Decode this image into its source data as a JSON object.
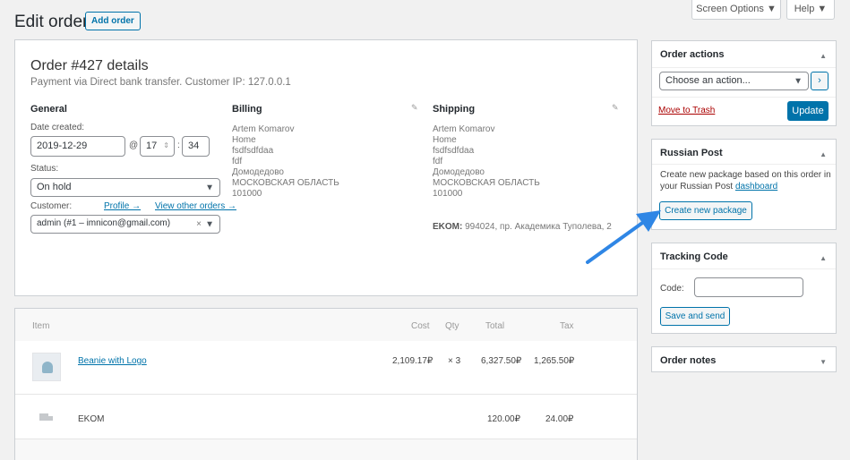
{
  "header": {
    "title": "Edit order",
    "add_order": "Add order",
    "screen_options": "Screen Options ▼",
    "help": "Help ▼"
  },
  "order": {
    "heading": "Order #427 details",
    "subheading": "Payment via Direct bank transfer. Customer IP: 127.0.0.1",
    "general": {
      "title": "General",
      "date_label": "Date created:",
      "date_value": "2019-12-29",
      "at": "@",
      "hour": "17",
      "minute": "34",
      "colon": ":",
      "status_label": "Status:",
      "status_value": "On hold",
      "customer_label": "Customer:",
      "profile_link": "Profile →",
      "other_orders_link": "View other orders →",
      "customer_value": "admin (#1 – imnicon@gmail.com)"
    },
    "billing": {
      "title": "Billing",
      "lines": [
        "Artem Komarov",
        "Home",
        "fsdfsdfdaa",
        "fdf",
        "Домодедово",
        "МОСКОВСКАЯ ОБЛАСТЬ",
        "101000"
      ]
    },
    "shipping": {
      "title": "Shipping",
      "lines": [
        "Artem Komarov",
        "Home",
        "fsdfsdfdaa",
        "fdf",
        "Домодедово",
        "МОСКОВСКАЯ ОБЛАСТЬ",
        "101000"
      ],
      "ekom_label": "EKOM:",
      "ekom_value": "994024, пр. Академика Туполева, 2"
    }
  },
  "items": {
    "headers": {
      "item": "Item",
      "cost": "Cost",
      "qty": "Qty",
      "total": "Total",
      "tax": "Tax"
    },
    "rows": [
      {
        "name": "Beanie with Logo",
        "cost": "2,109.17₽",
        "qty": "× 3",
        "total": "6,327.50₽",
        "tax": "1,265.50₽"
      }
    ],
    "shipping_row": {
      "name": "EKOM",
      "total": "120.00₽",
      "tax": "24.00₽"
    }
  },
  "sidebar": {
    "order_actions": {
      "title": "Order actions",
      "select": "Choose an action...",
      "trash": "Move to Trash",
      "update": "Update"
    },
    "russian_post": {
      "title": "Russian Post",
      "text": "Create new package based on this order in your Russian Post",
      "link": "dashboard",
      "button": "Create new package"
    },
    "tracking": {
      "title": "Tracking Code",
      "code_label": "Code:",
      "button": "Save and send"
    },
    "notes": {
      "title": "Order notes"
    }
  },
  "colors": {
    "accent": "#0073aa",
    "arrow": "#2f86e5",
    "trash": "#a00"
  }
}
